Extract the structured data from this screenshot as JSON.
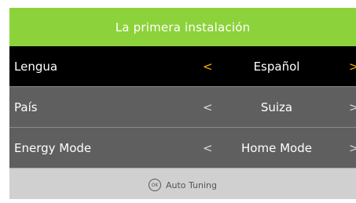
{
  "title": "La primera instalación",
  "rows": [
    {
      "label": "Lengua",
      "value": "Español",
      "left_arrow": "<",
      "right_arrow": ">"
    },
    {
      "label": "País",
      "value": "Suiza",
      "left_arrow": "<",
      "right_arrow": ">"
    },
    {
      "label": "Energy Mode",
      "value": "Home Mode",
      "left_arrow": "<",
      "right_arrow": ">"
    }
  ],
  "footer": {
    "icon_text": "OK",
    "label": "Auto Tuning"
  },
  "colors": {
    "title_bar": "#8cd23a",
    "selected_row": "#000000",
    "row": "#5f5f5f",
    "selected_arrow": "#f2b500",
    "footer": "#d0d0d0"
  }
}
